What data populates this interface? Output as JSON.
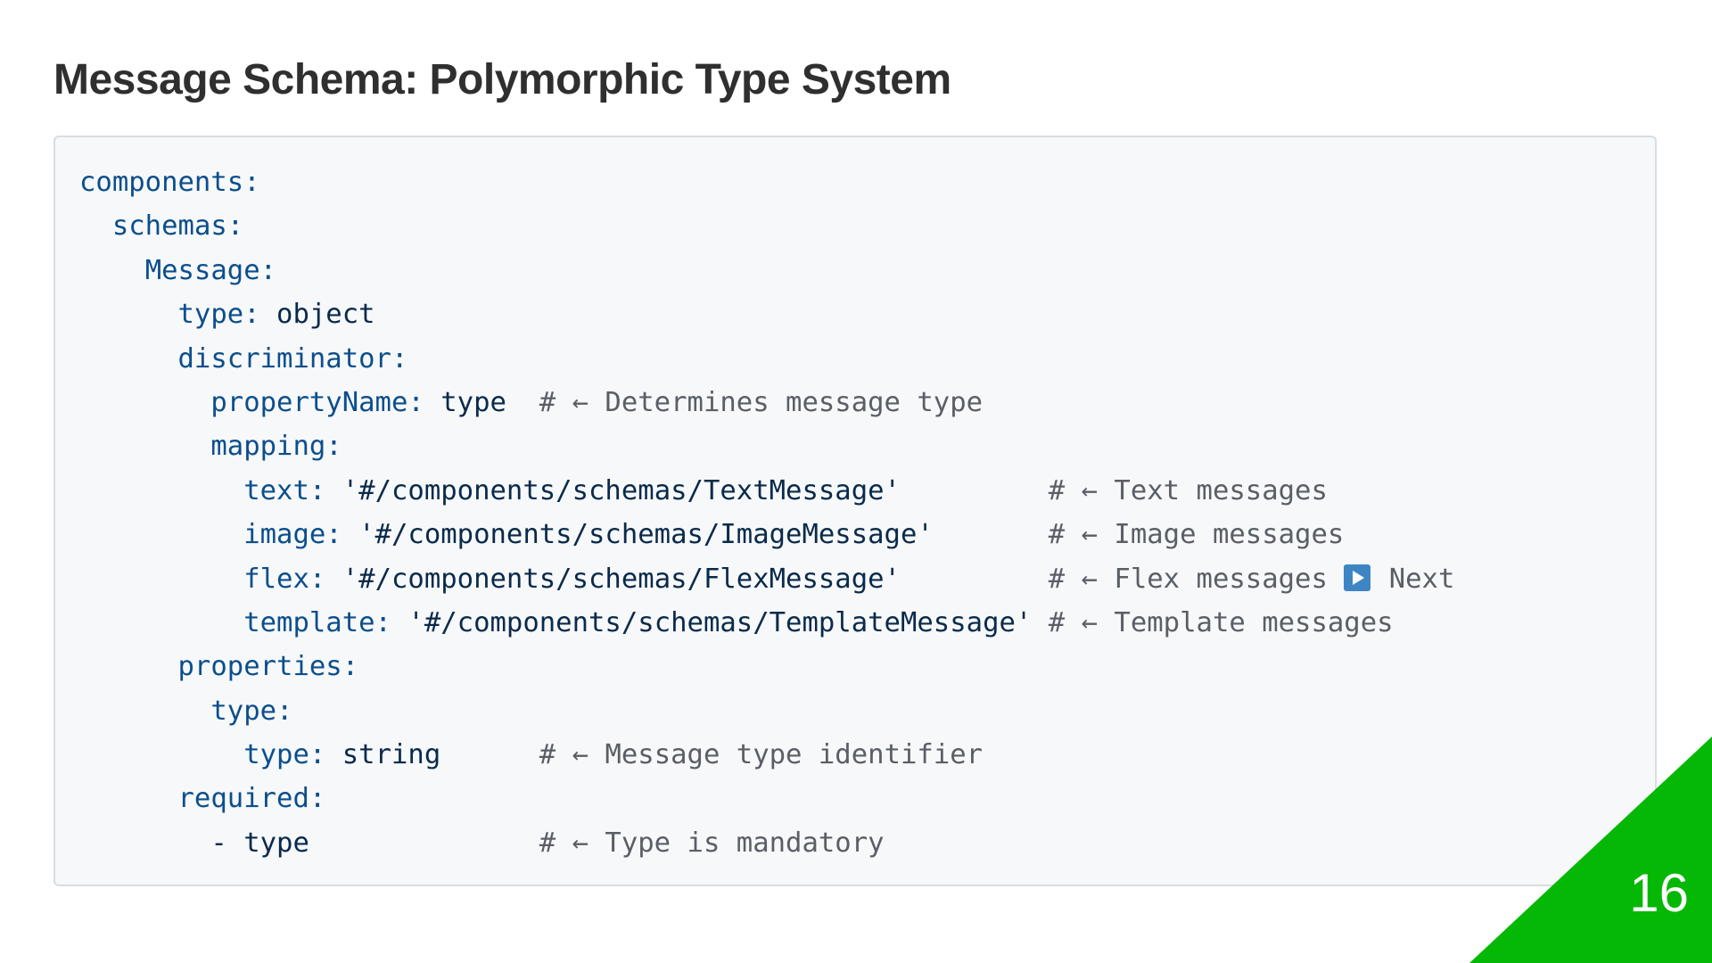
{
  "slide": {
    "title": "Message Schema: Polymorphic Type System",
    "page_number": "16",
    "accent_color": "#06b806"
  },
  "code": {
    "lines": [
      {
        "indent": "",
        "key": "components:",
        "value": "",
        "comment": ""
      },
      {
        "indent": "  ",
        "key": "schemas:",
        "value": "",
        "comment": ""
      },
      {
        "indent": "    ",
        "key": "Message:",
        "value": "",
        "comment": ""
      },
      {
        "indent": "      ",
        "key": "type:",
        "value": " object",
        "comment": ""
      },
      {
        "indent": "      ",
        "key": "discriminator:",
        "value": "",
        "comment": ""
      },
      {
        "indent": "        ",
        "key": "propertyName:",
        "value": " type  ",
        "comment": "# ← Determines message type"
      },
      {
        "indent": "        ",
        "key": "mapping:",
        "value": "",
        "comment": ""
      },
      {
        "indent": "          ",
        "key": "text:",
        "value": " '#/components/schemas/TextMessage'         ",
        "comment": "# ← Text messages"
      },
      {
        "indent": "          ",
        "key": "image:",
        "value": " '#/components/schemas/ImageMessage'       ",
        "comment": "# ← Image messages"
      },
      {
        "indent": "          ",
        "key": "flex:",
        "value": " '#/components/schemas/FlexMessage'         ",
        "comment": "# ← Flex messages ",
        "icon": "play-next-icon",
        "suffix": " Next"
      },
      {
        "indent": "          ",
        "key": "template:",
        "value": " '#/components/schemas/TemplateMessage' ",
        "comment": "# ← Template messages"
      },
      {
        "indent": "      ",
        "key": "properties:",
        "value": "",
        "comment": ""
      },
      {
        "indent": "        ",
        "key": "type:",
        "value": "",
        "comment": ""
      },
      {
        "indent": "          ",
        "key": "type:",
        "value": " string      ",
        "comment": "# ← Message type identifier"
      },
      {
        "indent": "      ",
        "key": "required:",
        "value": "",
        "comment": ""
      },
      {
        "indent": "        ",
        "key": "",
        "value": "- type              ",
        "comment": "# ← Type is mandatory"
      }
    ]
  }
}
